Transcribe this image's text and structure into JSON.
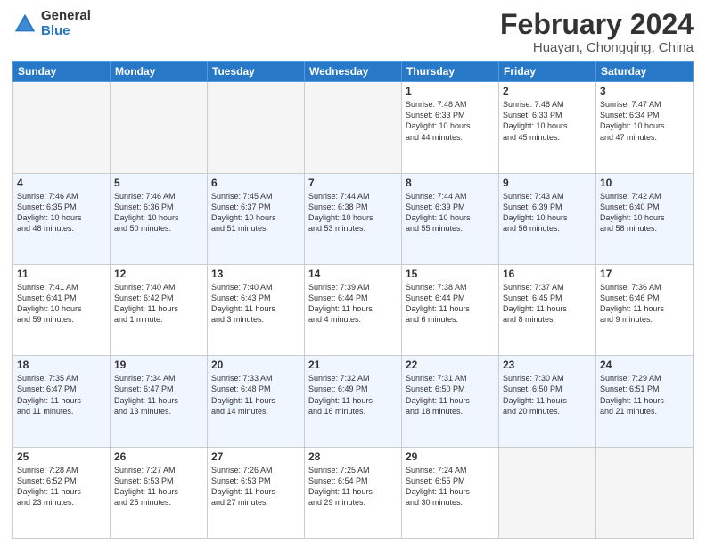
{
  "logo": {
    "general": "General",
    "blue": "Blue"
  },
  "title": "February 2024",
  "location": "Huayan, Chongqing, China",
  "weekdays": [
    "Sunday",
    "Monday",
    "Tuesday",
    "Wednesday",
    "Thursday",
    "Friday",
    "Saturday"
  ],
  "weeks": [
    [
      {
        "day": "",
        "info": "",
        "empty": true
      },
      {
        "day": "",
        "info": "",
        "empty": true
      },
      {
        "day": "",
        "info": "",
        "empty": true
      },
      {
        "day": "",
        "info": "",
        "empty": true
      },
      {
        "day": "1",
        "info": "Sunrise: 7:48 AM\nSunset: 6:33 PM\nDaylight: 10 hours\nand 44 minutes."
      },
      {
        "day": "2",
        "info": "Sunrise: 7:48 AM\nSunset: 6:33 PM\nDaylight: 10 hours\nand 45 minutes."
      },
      {
        "day": "3",
        "info": "Sunrise: 7:47 AM\nSunset: 6:34 PM\nDaylight: 10 hours\nand 47 minutes."
      }
    ],
    [
      {
        "day": "4",
        "info": "Sunrise: 7:46 AM\nSunset: 6:35 PM\nDaylight: 10 hours\nand 48 minutes."
      },
      {
        "day": "5",
        "info": "Sunrise: 7:46 AM\nSunset: 6:36 PM\nDaylight: 10 hours\nand 50 minutes."
      },
      {
        "day": "6",
        "info": "Sunrise: 7:45 AM\nSunset: 6:37 PM\nDaylight: 10 hours\nand 51 minutes."
      },
      {
        "day": "7",
        "info": "Sunrise: 7:44 AM\nSunset: 6:38 PM\nDaylight: 10 hours\nand 53 minutes."
      },
      {
        "day": "8",
        "info": "Sunrise: 7:44 AM\nSunset: 6:39 PM\nDaylight: 10 hours\nand 55 minutes."
      },
      {
        "day": "9",
        "info": "Sunrise: 7:43 AM\nSunset: 6:39 PM\nDaylight: 10 hours\nand 56 minutes."
      },
      {
        "day": "10",
        "info": "Sunrise: 7:42 AM\nSunset: 6:40 PM\nDaylight: 10 hours\nand 58 minutes."
      }
    ],
    [
      {
        "day": "11",
        "info": "Sunrise: 7:41 AM\nSunset: 6:41 PM\nDaylight: 10 hours\nand 59 minutes."
      },
      {
        "day": "12",
        "info": "Sunrise: 7:40 AM\nSunset: 6:42 PM\nDaylight: 11 hours\nand 1 minute."
      },
      {
        "day": "13",
        "info": "Sunrise: 7:40 AM\nSunset: 6:43 PM\nDaylight: 11 hours\nand 3 minutes."
      },
      {
        "day": "14",
        "info": "Sunrise: 7:39 AM\nSunset: 6:44 PM\nDaylight: 11 hours\nand 4 minutes."
      },
      {
        "day": "15",
        "info": "Sunrise: 7:38 AM\nSunset: 6:44 PM\nDaylight: 11 hours\nand 6 minutes."
      },
      {
        "day": "16",
        "info": "Sunrise: 7:37 AM\nSunset: 6:45 PM\nDaylight: 11 hours\nand 8 minutes."
      },
      {
        "day": "17",
        "info": "Sunrise: 7:36 AM\nSunset: 6:46 PM\nDaylight: 11 hours\nand 9 minutes."
      }
    ],
    [
      {
        "day": "18",
        "info": "Sunrise: 7:35 AM\nSunset: 6:47 PM\nDaylight: 11 hours\nand 11 minutes."
      },
      {
        "day": "19",
        "info": "Sunrise: 7:34 AM\nSunset: 6:47 PM\nDaylight: 11 hours\nand 13 minutes."
      },
      {
        "day": "20",
        "info": "Sunrise: 7:33 AM\nSunset: 6:48 PM\nDaylight: 11 hours\nand 14 minutes."
      },
      {
        "day": "21",
        "info": "Sunrise: 7:32 AM\nSunset: 6:49 PM\nDaylight: 11 hours\nand 16 minutes."
      },
      {
        "day": "22",
        "info": "Sunrise: 7:31 AM\nSunset: 6:50 PM\nDaylight: 11 hours\nand 18 minutes."
      },
      {
        "day": "23",
        "info": "Sunrise: 7:30 AM\nSunset: 6:50 PM\nDaylight: 11 hours\nand 20 minutes."
      },
      {
        "day": "24",
        "info": "Sunrise: 7:29 AM\nSunset: 6:51 PM\nDaylight: 11 hours\nand 21 minutes."
      }
    ],
    [
      {
        "day": "25",
        "info": "Sunrise: 7:28 AM\nSunset: 6:52 PM\nDaylight: 11 hours\nand 23 minutes."
      },
      {
        "day": "26",
        "info": "Sunrise: 7:27 AM\nSunset: 6:53 PM\nDaylight: 11 hours\nand 25 minutes."
      },
      {
        "day": "27",
        "info": "Sunrise: 7:26 AM\nSunset: 6:53 PM\nDaylight: 11 hours\nand 27 minutes."
      },
      {
        "day": "28",
        "info": "Sunrise: 7:25 AM\nSunset: 6:54 PM\nDaylight: 11 hours\nand 29 minutes."
      },
      {
        "day": "29",
        "info": "Sunrise: 7:24 AM\nSunset: 6:55 PM\nDaylight: 11 hours\nand 30 minutes."
      },
      {
        "day": "",
        "info": "",
        "empty": true
      },
      {
        "day": "",
        "info": "",
        "empty": true
      }
    ]
  ]
}
